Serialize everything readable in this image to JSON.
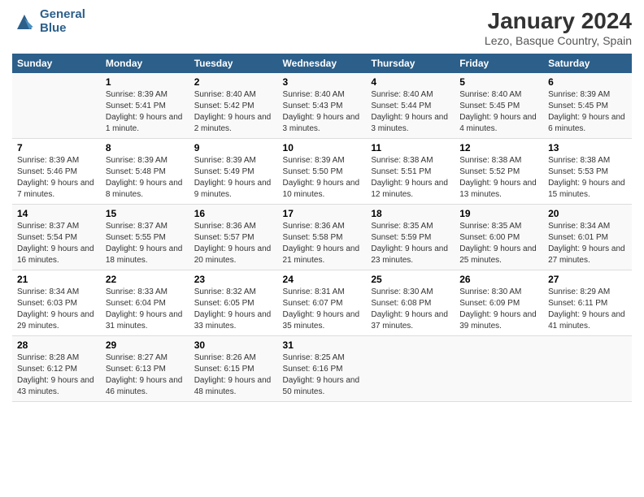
{
  "header": {
    "logo_line1": "General",
    "logo_line2": "Blue",
    "title": "January 2024",
    "subtitle": "Lezo, Basque Country, Spain"
  },
  "days_of_week": [
    "Sunday",
    "Monday",
    "Tuesday",
    "Wednesday",
    "Thursday",
    "Friday",
    "Saturday"
  ],
  "weeks": [
    [
      {
        "day": "",
        "sunrise": "",
        "sunset": "",
        "daylight": ""
      },
      {
        "day": "1",
        "sunrise": "Sunrise: 8:39 AM",
        "sunset": "Sunset: 5:41 PM",
        "daylight": "Daylight: 9 hours and 1 minute."
      },
      {
        "day": "2",
        "sunrise": "Sunrise: 8:40 AM",
        "sunset": "Sunset: 5:42 PM",
        "daylight": "Daylight: 9 hours and 2 minutes."
      },
      {
        "day": "3",
        "sunrise": "Sunrise: 8:40 AM",
        "sunset": "Sunset: 5:43 PM",
        "daylight": "Daylight: 9 hours and 3 minutes."
      },
      {
        "day": "4",
        "sunrise": "Sunrise: 8:40 AM",
        "sunset": "Sunset: 5:44 PM",
        "daylight": "Daylight: 9 hours and 3 minutes."
      },
      {
        "day": "5",
        "sunrise": "Sunrise: 8:40 AM",
        "sunset": "Sunset: 5:45 PM",
        "daylight": "Daylight: 9 hours and 4 minutes."
      },
      {
        "day": "6",
        "sunrise": "Sunrise: 8:39 AM",
        "sunset": "Sunset: 5:45 PM",
        "daylight": "Daylight: 9 hours and 6 minutes."
      }
    ],
    [
      {
        "day": "7",
        "sunrise": "Sunrise: 8:39 AM",
        "sunset": "Sunset: 5:46 PM",
        "daylight": "Daylight: 9 hours and 7 minutes."
      },
      {
        "day": "8",
        "sunrise": "Sunrise: 8:39 AM",
        "sunset": "Sunset: 5:48 PM",
        "daylight": "Daylight: 9 hours and 8 minutes."
      },
      {
        "day": "9",
        "sunrise": "Sunrise: 8:39 AM",
        "sunset": "Sunset: 5:49 PM",
        "daylight": "Daylight: 9 hours and 9 minutes."
      },
      {
        "day": "10",
        "sunrise": "Sunrise: 8:39 AM",
        "sunset": "Sunset: 5:50 PM",
        "daylight": "Daylight: 9 hours and 10 minutes."
      },
      {
        "day": "11",
        "sunrise": "Sunrise: 8:38 AM",
        "sunset": "Sunset: 5:51 PM",
        "daylight": "Daylight: 9 hours and 12 minutes."
      },
      {
        "day": "12",
        "sunrise": "Sunrise: 8:38 AM",
        "sunset": "Sunset: 5:52 PM",
        "daylight": "Daylight: 9 hours and 13 minutes."
      },
      {
        "day": "13",
        "sunrise": "Sunrise: 8:38 AM",
        "sunset": "Sunset: 5:53 PM",
        "daylight": "Daylight: 9 hours and 15 minutes."
      }
    ],
    [
      {
        "day": "14",
        "sunrise": "Sunrise: 8:37 AM",
        "sunset": "Sunset: 5:54 PM",
        "daylight": "Daylight: 9 hours and 16 minutes."
      },
      {
        "day": "15",
        "sunrise": "Sunrise: 8:37 AM",
        "sunset": "Sunset: 5:55 PM",
        "daylight": "Daylight: 9 hours and 18 minutes."
      },
      {
        "day": "16",
        "sunrise": "Sunrise: 8:36 AM",
        "sunset": "Sunset: 5:57 PM",
        "daylight": "Daylight: 9 hours and 20 minutes."
      },
      {
        "day": "17",
        "sunrise": "Sunrise: 8:36 AM",
        "sunset": "Sunset: 5:58 PM",
        "daylight": "Daylight: 9 hours and 21 minutes."
      },
      {
        "day": "18",
        "sunrise": "Sunrise: 8:35 AM",
        "sunset": "Sunset: 5:59 PM",
        "daylight": "Daylight: 9 hours and 23 minutes."
      },
      {
        "day": "19",
        "sunrise": "Sunrise: 8:35 AM",
        "sunset": "Sunset: 6:00 PM",
        "daylight": "Daylight: 9 hours and 25 minutes."
      },
      {
        "day": "20",
        "sunrise": "Sunrise: 8:34 AM",
        "sunset": "Sunset: 6:01 PM",
        "daylight": "Daylight: 9 hours and 27 minutes."
      }
    ],
    [
      {
        "day": "21",
        "sunrise": "Sunrise: 8:34 AM",
        "sunset": "Sunset: 6:03 PM",
        "daylight": "Daylight: 9 hours and 29 minutes."
      },
      {
        "day": "22",
        "sunrise": "Sunrise: 8:33 AM",
        "sunset": "Sunset: 6:04 PM",
        "daylight": "Daylight: 9 hours and 31 minutes."
      },
      {
        "day": "23",
        "sunrise": "Sunrise: 8:32 AM",
        "sunset": "Sunset: 6:05 PM",
        "daylight": "Daylight: 9 hours and 33 minutes."
      },
      {
        "day": "24",
        "sunrise": "Sunrise: 8:31 AM",
        "sunset": "Sunset: 6:07 PM",
        "daylight": "Daylight: 9 hours and 35 minutes."
      },
      {
        "day": "25",
        "sunrise": "Sunrise: 8:30 AM",
        "sunset": "Sunset: 6:08 PM",
        "daylight": "Daylight: 9 hours and 37 minutes."
      },
      {
        "day": "26",
        "sunrise": "Sunrise: 8:30 AM",
        "sunset": "Sunset: 6:09 PM",
        "daylight": "Daylight: 9 hours and 39 minutes."
      },
      {
        "day": "27",
        "sunrise": "Sunrise: 8:29 AM",
        "sunset": "Sunset: 6:11 PM",
        "daylight": "Daylight: 9 hours and 41 minutes."
      }
    ],
    [
      {
        "day": "28",
        "sunrise": "Sunrise: 8:28 AM",
        "sunset": "Sunset: 6:12 PM",
        "daylight": "Daylight: 9 hours and 43 minutes."
      },
      {
        "day": "29",
        "sunrise": "Sunrise: 8:27 AM",
        "sunset": "Sunset: 6:13 PM",
        "daylight": "Daylight: 9 hours and 46 minutes."
      },
      {
        "day": "30",
        "sunrise": "Sunrise: 8:26 AM",
        "sunset": "Sunset: 6:15 PM",
        "daylight": "Daylight: 9 hours and 48 minutes."
      },
      {
        "day": "31",
        "sunrise": "Sunrise: 8:25 AM",
        "sunset": "Sunset: 6:16 PM",
        "daylight": "Daylight: 9 hours and 50 minutes."
      },
      {
        "day": "",
        "sunrise": "",
        "sunset": "",
        "daylight": ""
      },
      {
        "day": "",
        "sunrise": "",
        "sunset": "",
        "daylight": ""
      },
      {
        "day": "",
        "sunrise": "",
        "sunset": "",
        "daylight": ""
      }
    ]
  ]
}
